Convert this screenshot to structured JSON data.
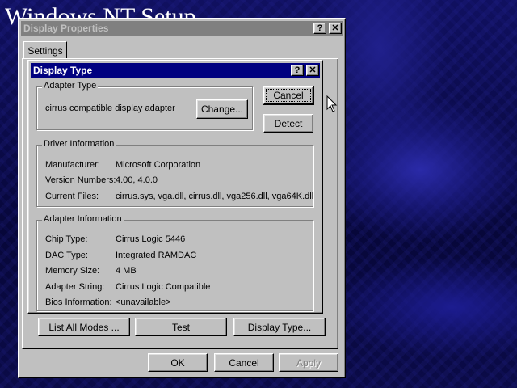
{
  "background": {
    "title": "Windows NT Setup"
  },
  "display_properties": {
    "title": "Display Properties",
    "help_glyph": "?",
    "close_glyph": "✕",
    "tabs": [
      {
        "label": "Settings"
      }
    ],
    "buttons": {
      "list_all_modes": "List All Modes ...",
      "test": "Test",
      "display_type": "Display Type..."
    },
    "footer": {
      "ok": "OK",
      "cancel": "Cancel",
      "apply": "Apply"
    }
  },
  "display_type": {
    "title": "Display Type",
    "help_glyph": "?",
    "close_glyph": "✕",
    "cancel_label": "Cancel",
    "detect_label": "Detect",
    "adapter_type": {
      "group_label": "Adapter Type",
      "value": "cirrus compatible display adapter",
      "change_label": "Change..."
    },
    "driver_info": {
      "group_label": "Driver Information",
      "rows": [
        {
          "label": "Manufacturer:",
          "value": "Microsoft Corporation"
        },
        {
          "label": "Version Numbers:",
          "value": "4.00, 4.0.0"
        },
        {
          "label": "Current Files:",
          "value": "cirrus.sys, vga.dll, cirrus.dll, vga256.dll, vga64K.dll"
        }
      ]
    },
    "adapter_info": {
      "group_label": "Adapter Information",
      "rows": [
        {
          "label": "Chip Type:",
          "value": "Cirrus Logic 5446"
        },
        {
          "label": "DAC Type:",
          "value": "Integrated RAMDAC"
        },
        {
          "label": "Memory Size:",
          "value": "4 MB"
        },
        {
          "label": "Adapter String:",
          "value": "Cirrus Logic Compatible"
        },
        {
          "label": "Bios Information:",
          "value": "<unavailable>"
        }
      ]
    }
  },
  "colors": {
    "active_title": "#000080",
    "inactive_title": "#808080",
    "face": "#c0c0c0"
  },
  "icons": {
    "pointer": "arrow-cursor-icon",
    "help": "question-mark-icon",
    "close": "close-x-icon"
  }
}
